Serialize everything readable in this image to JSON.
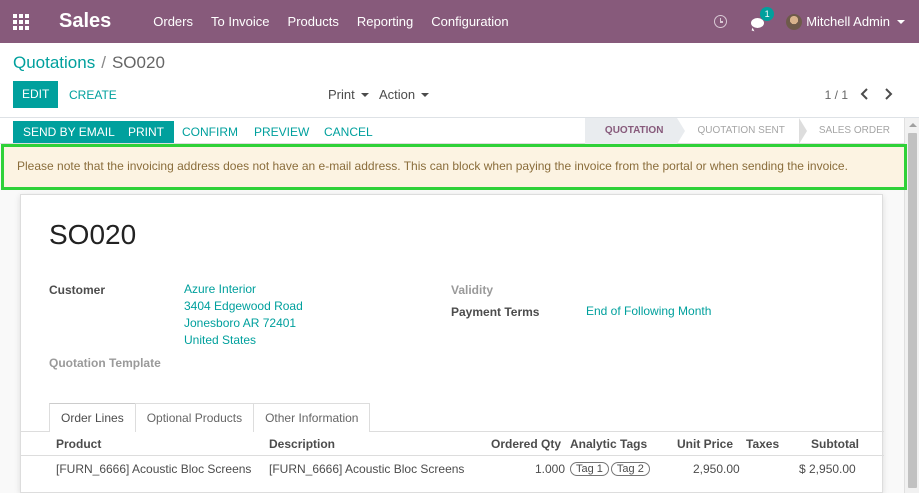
{
  "app": {
    "name": "Sales"
  },
  "menu": [
    "Orders",
    "To Invoice",
    "Products",
    "Reporting",
    "Configuration"
  ],
  "systray": {
    "messages_count": "1",
    "user_name": "Mitchell Admin"
  },
  "breadcrumb": {
    "parent": "Quotations",
    "separator": "/",
    "current": "SO020"
  },
  "control": {
    "edit": "EDIT",
    "create": "CREATE",
    "print": "Print",
    "action": "Action",
    "pager": "1 / 1"
  },
  "statusbar": {
    "buttons": [
      "SEND BY EMAIL",
      "PRINT",
      "CONFIRM",
      "PREVIEW",
      "CANCEL"
    ],
    "stages": [
      "QUOTATION",
      "QUOTATION SENT",
      "SALES ORDER"
    ],
    "active_stage": "QUOTATION"
  },
  "alert": {
    "text": "Please note that the invoicing address does not have an e-mail address. This can block when paying the invoice from the portal or when sending the invoice."
  },
  "form": {
    "name": "SO020",
    "customer_label": "Customer",
    "customer_lines": [
      "Azure Interior",
      "3404 Edgewood Road",
      "Jonesboro AR 72401",
      "United States"
    ],
    "template_label": "Quotation Template",
    "validity_label": "Validity",
    "payment_terms_label": "Payment Terms",
    "payment_terms_value": "End of Following Month"
  },
  "tabs": [
    "Order Lines",
    "Optional Products",
    "Other Information"
  ],
  "table": {
    "headers": [
      "Product",
      "Description",
      "Ordered Qty",
      "Analytic Tags",
      "Unit Price",
      "Taxes",
      "Subtotal"
    ],
    "rows": [
      {
        "product": "[FURN_6666] Acoustic Bloc Screens",
        "description": "[FURN_6666] Acoustic Bloc Screens",
        "qty": "1.000",
        "tags": [
          "Tag 1",
          "Tag 2"
        ],
        "unit_price": "2,950.00",
        "taxes": "",
        "subtotal": "$ 2,950.00"
      }
    ]
  },
  "colors": {
    "brand": "#875a7b",
    "accent": "#00a09d",
    "alert_bg": "#fcf3e2",
    "highlight": "#2fd138"
  }
}
